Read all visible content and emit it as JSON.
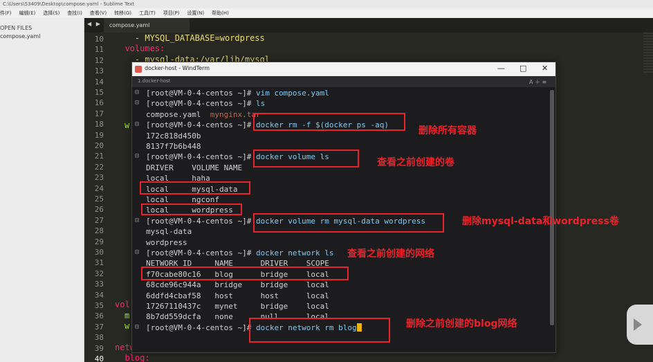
{
  "sublime": {
    "title": "C:\\Users\\53409\\Desktop\\compose.yaml - Sublime Text",
    "menu": [
      "件(F)",
      "编辑(E)",
      "选择(S)",
      "查找(I)",
      "查看(V)",
      "转移(G)",
      "工具(T)",
      "项目(P)",
      "设置(N)",
      "帮助(H)"
    ],
    "sidebar_header": "OPEN FILES",
    "open_file": "compose.yaml",
    "tab": "compose.yaml",
    "tab_arrows": "◀ ▶"
  },
  "editor_lines": [
    {
      "n": "10",
      "text": "    - MYSQL_DATABASE=wordpress"
    },
    {
      "n": "11",
      "text": "  volumes:"
    },
    {
      "n": "12",
      "text": "    - mysql-data:/var/lib/mysql"
    },
    {
      "n": "13",
      "text": ""
    },
    {
      "n": "14",
      "text": ""
    },
    {
      "n": "15",
      "text": ""
    },
    {
      "n": "16",
      "text": ""
    },
    {
      "n": "17",
      "text": ""
    },
    {
      "n": "18",
      "text": ""
    },
    {
      "n": "19",
      "text": ""
    },
    {
      "n": "20",
      "text": ""
    },
    {
      "n": "21",
      "text": ""
    },
    {
      "n": "22",
      "text": ""
    },
    {
      "n": "23",
      "text": ""
    },
    {
      "n": "24",
      "text": ""
    },
    {
      "n": "25",
      "text": ""
    },
    {
      "n": "26",
      "text": ""
    },
    {
      "n": "27",
      "text": ""
    },
    {
      "n": "28",
      "text": ""
    },
    {
      "n": "29",
      "text": ""
    },
    {
      "n": "30",
      "text": ""
    },
    {
      "n": "31",
      "text": ""
    },
    {
      "n": "32",
      "text": ""
    },
    {
      "n": "33",
      "text": ""
    },
    {
      "n": "34",
      "text": ""
    },
    {
      "n": "35",
      "text": ""
    },
    {
      "n": "36",
      "text": ""
    },
    {
      "n": "37",
      "text": ""
    },
    {
      "n": "38",
      "text": ""
    },
    {
      "n": "39",
      "text": "networks:"
    },
    {
      "n": "40",
      "text": "  blog:"
    }
  ],
  "editor_side": {
    "vol": "vol",
    "w1": "w",
    "m": "m",
    "w2": "w"
  },
  "windterm": {
    "title": "docker-host - WindTerm",
    "tab": "1.docker-host",
    "controls": {
      "min": "—",
      "max": "□",
      "close": "✕"
    },
    "tab_right": "A  ＋  ≡",
    "prompt": "[root@VM-0-4-centos ~]#"
  },
  "terminal": [
    {
      "type": "cmd",
      "cmd": " vim compose.yaml"
    },
    {
      "type": "cmd",
      "cmd": " ls"
    },
    {
      "type": "out",
      "text": "compose.yaml  ",
      "extra": "mynginx.tar"
    },
    {
      "type": "cmd",
      "cmd": " docker rm -f $(docker ps -aq)"
    },
    {
      "type": "out",
      "text": "172c818d450b"
    },
    {
      "type": "out",
      "text": "8137f7b6b448"
    },
    {
      "type": "cmd",
      "cmd": " docker volume ls"
    },
    {
      "type": "out",
      "text": "DRIVER    VOLUME NAME"
    },
    {
      "type": "out",
      "text": "local     haha"
    },
    {
      "type": "out",
      "text": "local     mysql-data"
    },
    {
      "type": "out",
      "text": "local     ngconf"
    },
    {
      "type": "out",
      "text": "local     wordpress"
    },
    {
      "type": "cmd",
      "cmd": " docker volume rm mysql-data wordpress"
    },
    {
      "type": "out",
      "text": "mysql-data"
    },
    {
      "type": "out",
      "text": "wordpress"
    },
    {
      "type": "cmd",
      "cmd": " docker network ls"
    },
    {
      "type": "out",
      "text": "NETWORK ID     NAME      DRIVER    SCOPE"
    },
    {
      "type": "out",
      "text": "f70cabe80c16   blog      bridge    local"
    },
    {
      "type": "out",
      "text": "68cde96c944a   bridge    bridge    local"
    },
    {
      "type": "out",
      "text": "6ddfd4cbaf58   host      host      local"
    },
    {
      "type": "out",
      "text": "17267110437c   mynet     bridge    local"
    },
    {
      "type": "out",
      "text": "8b7dd559dcfa   none      null      local"
    },
    {
      "type": "cmd",
      "cmd": " docker network rm blog",
      "cursor": true
    }
  ],
  "annotations": [
    "删除所有容器",
    "查看之前创建的卷",
    "删除mysql-data和wordpress卷",
    "查看之前创建的网络",
    "删除之前创建的blog网络"
  ],
  "colors": {
    "annotation": "#e8232c",
    "command": "#7ec8f0",
    "cursor": "#f0b400"
  }
}
